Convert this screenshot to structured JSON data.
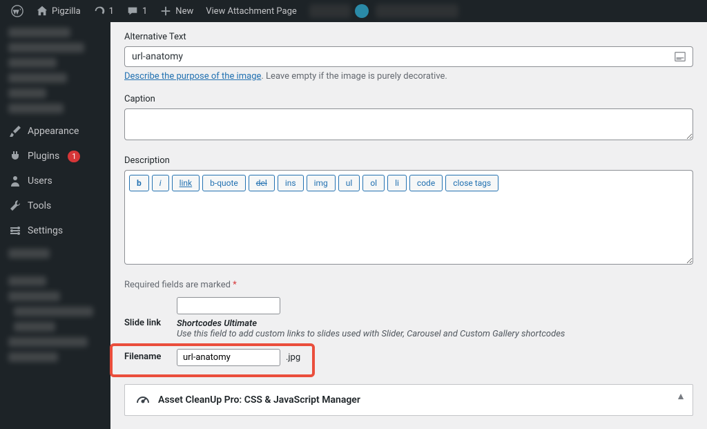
{
  "toolbar": {
    "site_name": "Pigzilla",
    "refresh_count": "1",
    "comment_count": "1",
    "new_label": "New",
    "view_label": "View Attachment Page"
  },
  "sidebar": {
    "appearance": "Appearance",
    "plugins": "Plugins",
    "plugins_badge": "1",
    "users": "Users",
    "tools": "Tools",
    "settings": "Settings"
  },
  "form": {
    "alt_label": "Alternative Text",
    "alt_value": "url-anatomy",
    "alt_help_link": "Describe the purpose of the image",
    "alt_help_rest": ". Leave empty if the image is purely decorative.",
    "caption_label": "Caption",
    "caption_value": "",
    "desc_label": "Description",
    "desc_value": "",
    "tb": {
      "b": "b",
      "i": "i",
      "link": "link",
      "bquote": "b-quote",
      "del": "del",
      "ins": "ins",
      "img": "img",
      "ul": "ul",
      "ol": "ol",
      "li": "li",
      "code": "code",
      "close": "close tags"
    },
    "required_text": "Required fields are marked ",
    "required_ast": "*",
    "slide_label": "Slide link",
    "slide_value": "",
    "slide_title": "Shortcodes Ultimate",
    "slide_desc": "Use this field to add custom links to slides used with Slider, Carousel and Custom Gallery shortcodes",
    "filename_label": "Filename",
    "filename_value": "url-anatomy",
    "filename_ext": ".jpg"
  },
  "panel": {
    "title": "Asset CleanUp Pro: CSS & JavaScript Manager"
  }
}
